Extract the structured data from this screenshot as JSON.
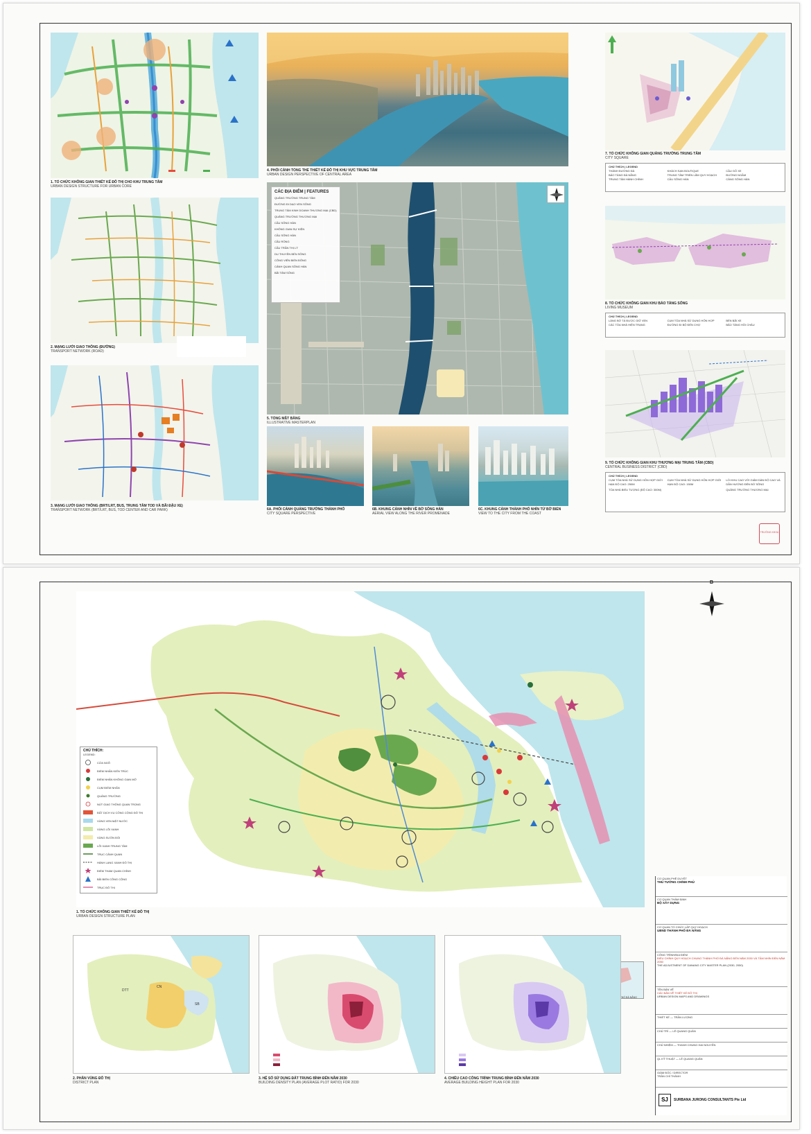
{
  "sheet_top": {
    "panels": {
      "urban_core": {
        "title_vi": "1. TỔ CHỨC KHÔNG GIAN THIẾT KẾ ĐÔ THỊ CHO KHU TRUNG TÂM",
        "title_en": "URBAN DESIGN STRUCTURE FOR URBAN CORE"
      },
      "transport_road": {
        "title_vi": "2. MẠNG LƯỚI GIAO THÔNG (ĐƯỜNG)",
        "title_en": "TRANSPORT NETWORK (ROAD)"
      },
      "transport_brt": {
        "title_vi": "3. MẠNG LƯỚI GIAO THÔNG (BRT/LRT, BUS, TRUNG TÂM TOD VÀ BÃI ĐẬU XE)",
        "title_en": "TRANSPORT NETWORK (BRT/LRT, BUS, TOD CENTER AND CAR PARK)"
      },
      "central_perspective": {
        "title_vi": "4. PHỐI CẢNH TỔNG THỂ THIẾT KẾ ĐÔ THỊ KHU VỰC TRUNG TÂM",
        "title_en": "URBAN DESIGN PERSPECTIVE OF CENTRAL AREA"
      },
      "masterplan": {
        "title_vi": "5. TỔNG MẶT BẰNG",
        "title_en": "ILLUSTRATIVE MASTERPLAN"
      },
      "view_6a": {
        "title_vi": "6A. PHỐI CẢNH QUẢNG TRƯỜNG THÀNH PHỐ",
        "title_en": "CITY SQUARE PERSPECTIVE"
      },
      "view_6b": {
        "title_vi": "6B. KHUNG CẢNH NHÌN VỀ BỜ SÔNG HÀN",
        "title_en": "AERIAL VIEW ALONG THE RIVER PROMENADE"
      },
      "view_6c": {
        "title_vi": "6C. KHUNG CẢNH THÀNH PHỐ NHÌN TỪ BỜ BIỂN",
        "title_en": "VIEW TO THE CITY FROM THE COAST"
      },
      "city_square": {
        "title_vi": "7. TỔ CHỨC KHÔNG GIAN QUẢNG TRƯỜNG TRUNG TÂM",
        "title_en": "CITY SQUARE"
      },
      "living_museum": {
        "title_vi": "8. TỔ CHỨC KHÔNG GIAN KHU BẢO TÀNG SỐNG",
        "title_en": "LIVING MUSEUM"
      },
      "cbd": {
        "title_vi": "9. TỔ CHỨC KHÔNG GIAN KHU THƯƠNG MẠI TRUNG TÂM (CBD)",
        "title_en": "CENTRAL BUSINESS DISTRICT (CBD)"
      }
    },
    "features": {
      "heading": "CÁC ĐỊA ĐIỂM | FEATURES",
      "items": [
        "QUẢNG TRƯỜNG TRUNG TÂM",
        "ĐƯỜNG ĐI DẠO VEN SÔNG",
        "TRUNG TÂM KINH DOANH THƯƠNG MẠI (CBD)",
        "QUẢNG TRƯỜNG THƯƠNG MẠI",
        "CẦU SÔNG HÀN",
        "KHÔNG GIAN SỰ KIỆN",
        "CẦU SÔNG HÀN",
        "CẦU RỒNG",
        "CẦU TRẦN THỊ LÝ",
        "DU THUYỀN BẾN SÔNG",
        "CÔNG VIÊN BIỂN ĐÔNG",
        "CẢNH QUAN SÔNG HÀN",
        "BÃI TẮM SÔNG"
      ]
    },
    "legend7": {
      "heading": "CHÚ THÍCH | LEGEND",
      "items": [
        "THÁNH ĐƯỜNG ĐÀ",
        "BẢO TÀNG ĐÀ NẴNG",
        "TRUNG TÂM HÀNH CHÍNH",
        "KHÁCH SẠN BOUTIQUE",
        "TRUNG TÂM TRIỂN LÃM QUY HOẠCH",
        "CẦU SÔNG HÀN",
        "CẦU GỖ XE",
        "ĐƯỜNG NGẦM",
        "CẢNG SÔNG HÀN"
      ]
    },
    "legend8": {
      "heading": "CHÚ THÍCH | LEGEND",
      "items": [
        "LÀNG BỜ TÁ ĐƯỢC GIỮ VẸN",
        "CÁC TÒA NHÀ HIỆN TRẠNG",
        "CỤM TÒA NHÀ SỬ DỤNG HỖN HỢP",
        "ĐƯỜNG ĐI BỘ ĐẾN CHỢ",
        "BẾN BÃI XE",
        "BẢO TÀNG HỒI CHÂU"
      ]
    },
    "legend9": {
      "heading": "CHÚ THÍCH | LEGEND",
      "items": [
        "CỤM TÒA NHÀ SỬ DỤNG HỖN HỢP GIỚI HẠN ĐỘ CAO: 250M",
        "CỤM TÒA NHÀ SỬ DỤNG HỖN HỢP GIỚI HẠN ĐỘ CAO: 150M",
        "TÒA NHÀ BIỂU TƯỢNG (ĐỘ CAO: 300M)",
        "LỐI KHU CAO VỚI GIẢM DÀN ĐỘ CAO VÀ DẪN HƯỚNG ĐẾN BỜ SÔNG",
        "QUẢNG TRƯỜNG THƯƠNG MẠI"
      ]
    },
    "stamp": "TRƯỞNG KHOA"
  },
  "sheet_bottom": {
    "north_label": "B",
    "legend": {
      "heading_vi": "CHÚ THÍCH:",
      "heading_en": "LEGEND:",
      "items": [
        {
          "vi": "CỬA NGÕ",
          "en": "GATEWAY"
        },
        {
          "vi": "ĐIỂM NHẤN KIẾN TRÚC",
          "en": "LANDMARK - BUILDING"
        },
        {
          "vi": "ĐIỂM NHẤN KHÔNG GIAN MỞ",
          "en": "LANDMARK - OPEN SPACE"
        },
        {
          "vi": "CỤM ĐIỂM NHẤN",
          "en": "LANDMARK - CLUSTER"
        },
        {
          "vi": "QUẢNG TRƯỜNG",
          "en": "SQUARE"
        },
        {
          "vi": "NÚT GIAO THÔNG QUAN TRỌNG",
          "en": "IMPORTANT TRANSPORT JUNCTION"
        },
        {
          "vi": "ĐẤT DỊCH VỤ CÔNG CỘNG ĐÔ THỊ",
          "en": "URBAN PUBLIC LAND"
        },
        {
          "vi": "VÙNG VEN MẶT NƯỚC",
          "en": "WATERFRONT ZONE"
        },
        {
          "vi": "VÙNG LÕI XANH",
          "en": "CENTRAL GREEN ZONE"
        },
        {
          "vi": "VÙNG SƯỜN ĐỒI",
          "en": "HILLSIDE ZONE"
        },
        {
          "vi": "LÕI XANH TRUNG TÂM",
          "en": "CENTRAL PARK"
        },
        {
          "vi": "TRỤC CẢNH QUAN",
          "en": "LANDSCAPE AXIS"
        },
        {
          "vi": "HÀNH LANG XANH ĐÔ THỊ",
          "en": "URBAN GREEN CORRIDOR"
        },
        {
          "vi": "ĐIỂM THAM QUAN CHÍNH",
          "en": "IMPORTANT ATTRACTIONS"
        },
        {
          "vi": "BÃI BIỂN CÔNG CỘNG",
          "en": "PUBLIC BEACH"
        },
        {
          "vi": "TRỤC ĐÔ THỊ",
          "en": "URBAN AXIS"
        }
      ]
    },
    "main_caption_vi": "1. TỔ CHỨC KHÔNG GIAN THIẾT KẾ ĐÔ THỊ",
    "main_caption_en": "URBAN DESIGN STRUCTURE PLAN",
    "inset_caption": "MINH HỌA VỊ TRÍ KHU VỰC THÀNH PHỐ ĐÀ NẴNG",
    "sub_maps": [
      {
        "caption_vi": "2. PHÂN VÙNG ĐÔ THỊ",
        "caption_en": "DISTRICT PLAN",
        "labels": [
          "DTT",
          "CN",
          "SB"
        ]
      },
      {
        "caption_vi": "3. HỆ SỐ SỬ DỤNG ĐẤT TRUNG BÌNH ĐẾN NĂM 2030",
        "caption_en": "BUILDING DENSITY PLAN (AVERAGE PLOT RATIO) FOR 2030"
      },
      {
        "caption_vi": "4. CHIỀU CAO CÔNG TRÌNH TRUNG BÌNH ĐẾN NĂM 2030",
        "caption_en": "AVERAGE BUILDING HEIGHT PLAN FOR 2030"
      }
    ],
    "title_block": {
      "approving_label": "CƠ QUAN PHÊ DUYỆT",
      "approving": "THỦ TƯỚNG CHÍNH PHỦ",
      "appraising_label": "CƠ QUAN THẨM ĐỊNH",
      "appraising": "BỘ XÂY DỰNG",
      "organizing_label": "CƠ QUAN TỔ CHỨC LẬP QUY HOẠCH",
      "organizing": "UBND THÀNH PHỐ ĐÀ NẴNG",
      "project_label": "CÔNG TRÌNH/ĐỊA ĐIỂM",
      "project_vi": "ĐIỀU CHỈNH QUY HOẠCH CHUNG THÀNH PHỐ ĐÀ NẴNG ĐẾN NĂM 2030 VÀ TẦM NHÌN ĐẾN NĂM 2050",
      "project_en": "THE ADJUSTMENT OF DANANG CITY MASTER PLAN (2030, 2050)",
      "drawing_label": "TÊN BẢN VẼ",
      "drawing_vi": "CÁC BẢN VẼ THIẾT KẾ ĐÔ THỊ",
      "drawing_en": "URBAN DESIGN MAPS AND DRAWINGS",
      "rows": [
        {
          "label": "THIẾT KẾ",
          "value": "TRẦN LƯỢNG"
        },
        {
          "label": "CHỦ TRÌ",
          "value": "LÊ QUANG QUÂN"
        },
        {
          "label": "CHỦ NHIỆM",
          "value": "THANH CHUNG HAI NGUYỄN"
        },
        {
          "label": "QL KỸ THUẬT",
          "value": "LÊ QUANG QUÂN"
        },
        {
          "label": "GIÁM ĐỐC / DIRECTOR",
          "value": "TRẦN CHÍ THÀNH"
        }
      ],
      "company": "SURBANA JURONG CONSULTANTS Pte Ltd",
      "logo": "SJ"
    }
  },
  "colors": {
    "sea": "#bfe6ec",
    "land": "#e8f1c8",
    "green": "#6aa84f",
    "dark_green": "#3d7a2a",
    "pink": "#e58fb0",
    "purple": "#8e6ad8",
    "yellow": "#f2e38a",
    "red": "#d83a3a",
    "blue": "#2a72c9"
  }
}
